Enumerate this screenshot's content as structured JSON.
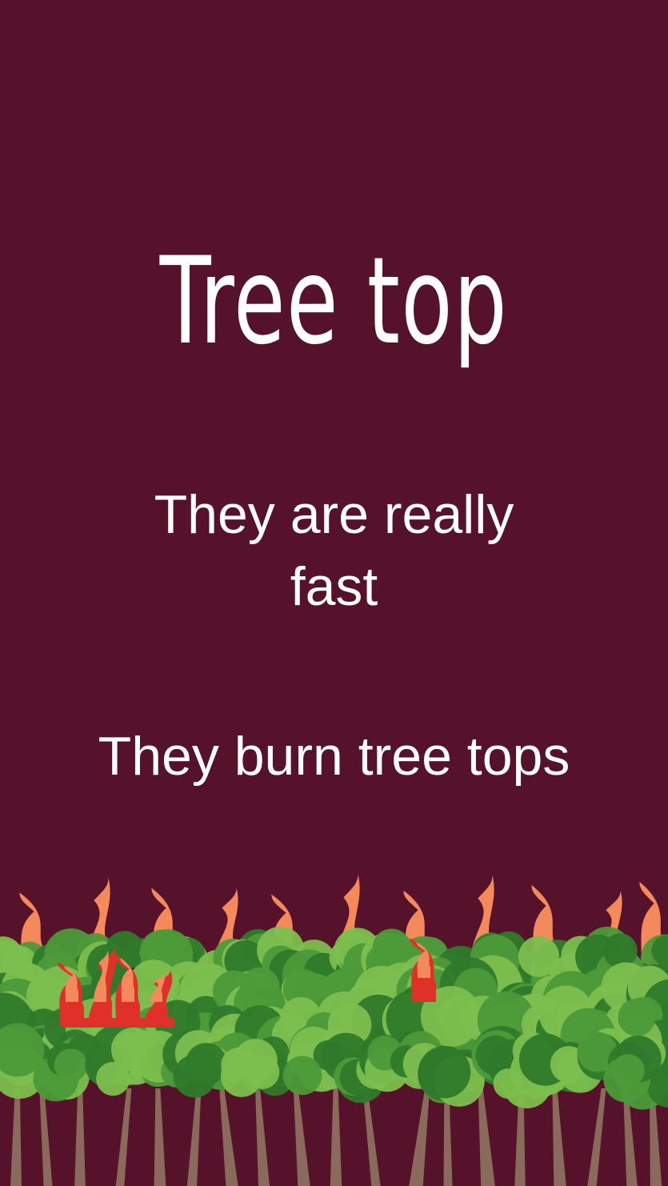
{
  "title": "Tree top",
  "statements": {
    "line1_a": "They are really",
    "line1_b": "fast",
    "line2": "They burn tree tops"
  },
  "colors": {
    "background": "#56122a",
    "text": "#ffffff",
    "foliage_dark": "#2f7a2a",
    "foliage_mid": "#4c9a38",
    "foliage_light": "#7cbf4e",
    "trunk": "#8a6a5a",
    "flame_outer": "#e0302a",
    "flame_inner": "#f48a5c"
  },
  "icons": {
    "forest": "burning-forest-illustration",
    "flame": "flame-icon",
    "tree": "tree-icon"
  }
}
